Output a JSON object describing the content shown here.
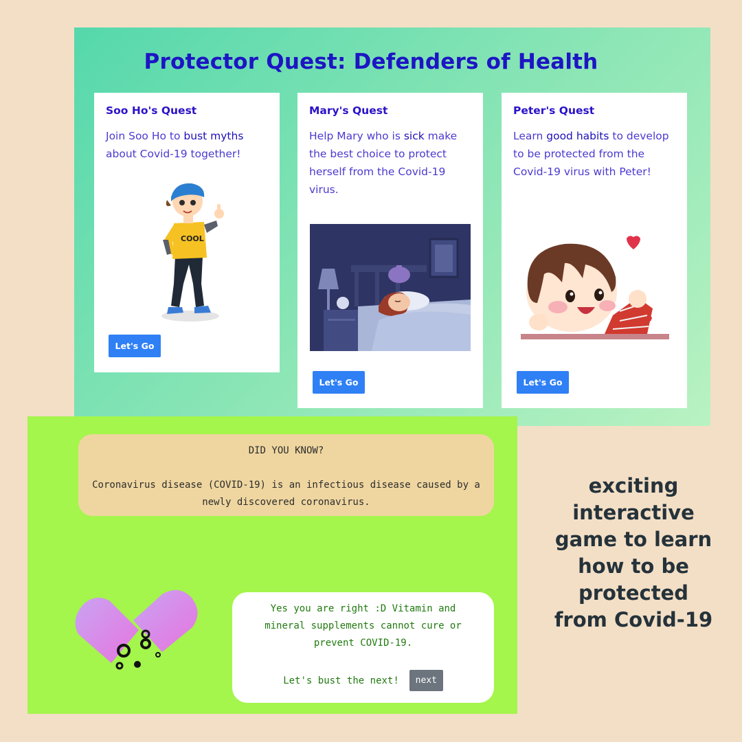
{
  "game": {
    "title": "Protector Quest: Defenders of Health",
    "quests": [
      {
        "title": "Soo Ho's Quest",
        "text_before": "Join Soo Ho to ",
        "highlight": "bust myths",
        "text_after": " about Covid-19 together!",
        "button_label": "Let's Go",
        "illustration": "boy-cap-thumbs-up"
      },
      {
        "title": "Mary's Quest",
        "text_before": "Help Mary who is ",
        "highlight": "sick",
        "text_after": " make the best choice to protect herself from the Covid-19 virus.",
        "button_label": "Let's Go",
        "illustration": "sick-girl-in-bed"
      },
      {
        "title": "Peter's Quest",
        "text_before": "Learn ",
        "highlight": "good habits",
        "text_after": " to develop to be protected from the Covid-19 virus with Peter!",
        "button_label": "Let's Go",
        "illustration": "happy-boy-with-heart"
      }
    ]
  },
  "did_you_know": {
    "heading": "DID YOU KNOW?",
    "body": "Coronavirus disease (COVID-19) is an infectious disease caused by a newly discovered coronavirus."
  },
  "answer": {
    "text": "Yes you are right :D Vitamin and mineral supplements cannot cure or prevent COVID-19.",
    "prompt": "Let's bust the next!",
    "next_label": "next",
    "illustration": "broken-pill-capsule"
  },
  "caption": {
    "lines": [
      "exciting",
      "interactive",
      "game to learn",
      "how to be",
      "protected",
      "from Covid-19"
    ]
  },
  "colors": {
    "background": "#f3dfc6",
    "title_blue": "#1d15c4",
    "button_blue": "#2f80f5",
    "green_panel": "#a4f54c",
    "info_box": "#efd6a0",
    "answer_green": "#217a0f",
    "next_gray": "#6c757d",
    "caption": "#25323a"
  }
}
